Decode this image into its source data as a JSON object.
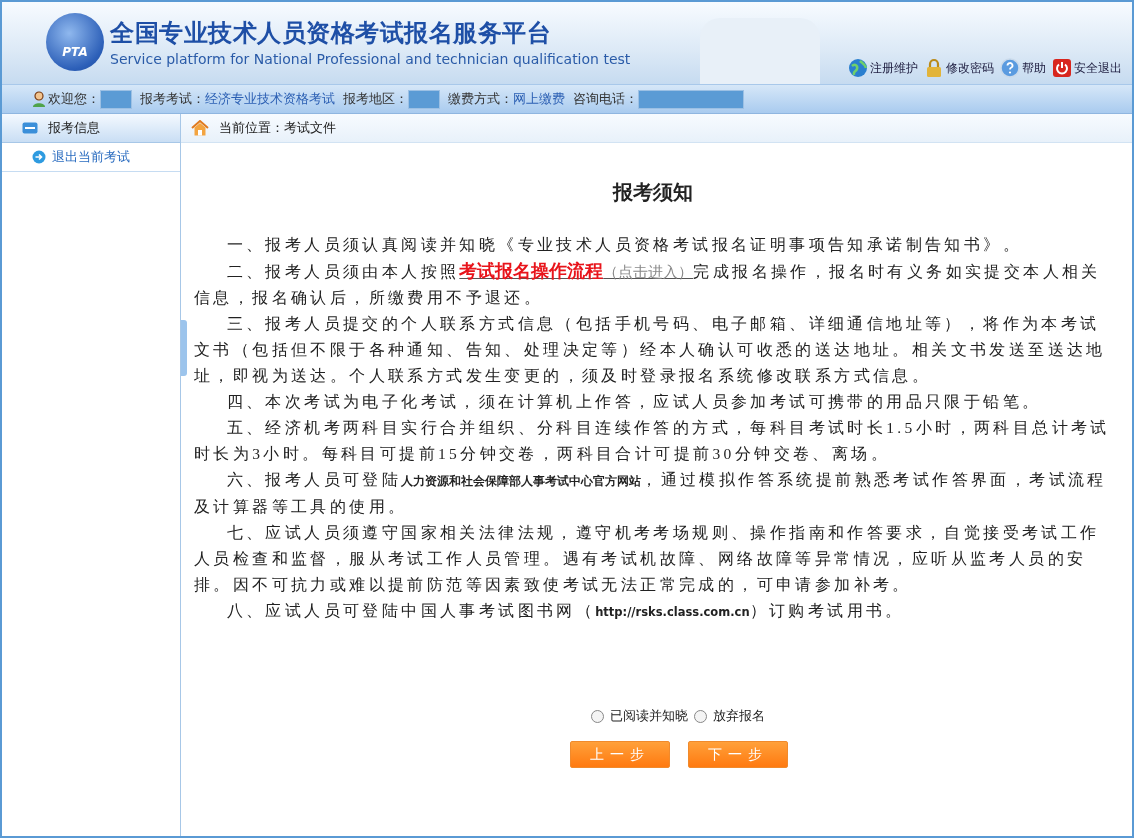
{
  "header": {
    "logo_text": "PTA",
    "title": "全国专业技术人员资格考试报名服务平台",
    "subtitle": "Service platform for National Professional and technician qualification test",
    "links": [
      {
        "kind": "globe",
        "label": "注册维护"
      },
      {
        "kind": "lock",
        "label": "修改密码"
      },
      {
        "kind": "help",
        "label": "帮助"
      },
      {
        "kind": "power",
        "label": "安全退出"
      }
    ]
  },
  "info_bar": [
    {
      "label": "欢迎您：",
      "kind": "masked"
    },
    {
      "label": "报考考试：",
      "kind": "text",
      "value": "经济专业技术资格考试"
    },
    {
      "label": "报考地区：",
      "kind": "masked"
    },
    {
      "label": "缴费方式：",
      "kind": "text",
      "value": "网上缴费"
    },
    {
      "label": "咨询电话：",
      "kind": "masked_wide"
    }
  ],
  "sidebar": {
    "heading": "报考信息",
    "items": [
      {
        "label": "退出当前考试"
      }
    ]
  },
  "breadcrumb": "当前位置：考试文件",
  "notice": {
    "title": "报考须知",
    "paragraphs": [
      {
        "segments": [
          {
            "kind": "text",
            "text": "一、报考人员须认真阅读并知晓《专业技术人员资格考试报名证明事项告知承诺制告知书》。"
          }
        ]
      },
      {
        "segments": [
          {
            "kind": "text",
            "text": "二、报考人员须由本人按照"
          },
          {
            "kind": "link",
            "text": "考试报名操作流程",
            "hint": "（点击进入）"
          },
          {
            "kind": "text",
            "text": "完成报名操作，报名时有义务如实提交本人相关信息，报名确认后，所缴费用不予退还。"
          }
        ]
      },
      {
        "segments": [
          {
            "kind": "text",
            "text": "三、报考人员提交的个人联系方式信息（包括手机号码、电子邮箱、详细通信地址等），将作为本考试文书（包括但不限于各种通知、告知、处理决定等）经本人确认可收悉的送达地址。相关文书发送至送达地址，即视为送达。个人联系方式发生变更的，须及时登录报名系统修改联系方式信息。"
          }
        ]
      },
      {
        "segments": [
          {
            "kind": "text",
            "text": "四、本次考试为电子化考试，须在计算机上作答，应试人员参加考试可携带的用品只限于铅笔。"
          }
        ]
      },
      {
        "segments": [
          {
            "kind": "text",
            "text": "五、经济机考两科目实行合并组织、分科目连续作答的方式，每科目考试时长1.5小时，两科目总计考试时长为3小时。每科目可提前15分钟交卷，两科目合计可提前30分钟交卷、离场。"
          }
        ]
      },
      {
        "segments": [
          {
            "kind": "text",
            "text": "六、报考人员可登陆"
          },
          {
            "kind": "small",
            "text": "人力资源和社会保障部人事考试中心官方网站"
          },
          {
            "kind": "text",
            "text": "，通过模拟作答系统提前熟悉考试作答界面，考试流程及计算器等工具的使用。"
          }
        ]
      },
      {
        "segments": [
          {
            "kind": "text",
            "text": "七、应试人员须遵守国家相关法律法规，遵守机考考场规则、操作指南和作答要求，自觉接受考试工作人员检查和监督，服从考试工作人员管理。遇有考试机故障、网络故障等异常情况，应听从监考人员的安排。因不可抗力或难以提前防范等因素致使考试无法正常完成的，可申请参加补考。"
          }
        ]
      },
      {
        "segments": [
          {
            "kind": "text",
            "text": "八、应试人员可登陆中国人事考试图书网（"
          },
          {
            "kind": "small",
            "text": "http://rsks.class.com.cn"
          },
          {
            "kind": "text",
            "text": "）订购考试用书。"
          }
        ]
      }
    ]
  },
  "options": [
    {
      "label": "已阅读并知晓",
      "selected": false
    },
    {
      "label": "放弃报名",
      "selected": false
    }
  ],
  "buttons": [
    "上一步",
    "下一步"
  ]
}
